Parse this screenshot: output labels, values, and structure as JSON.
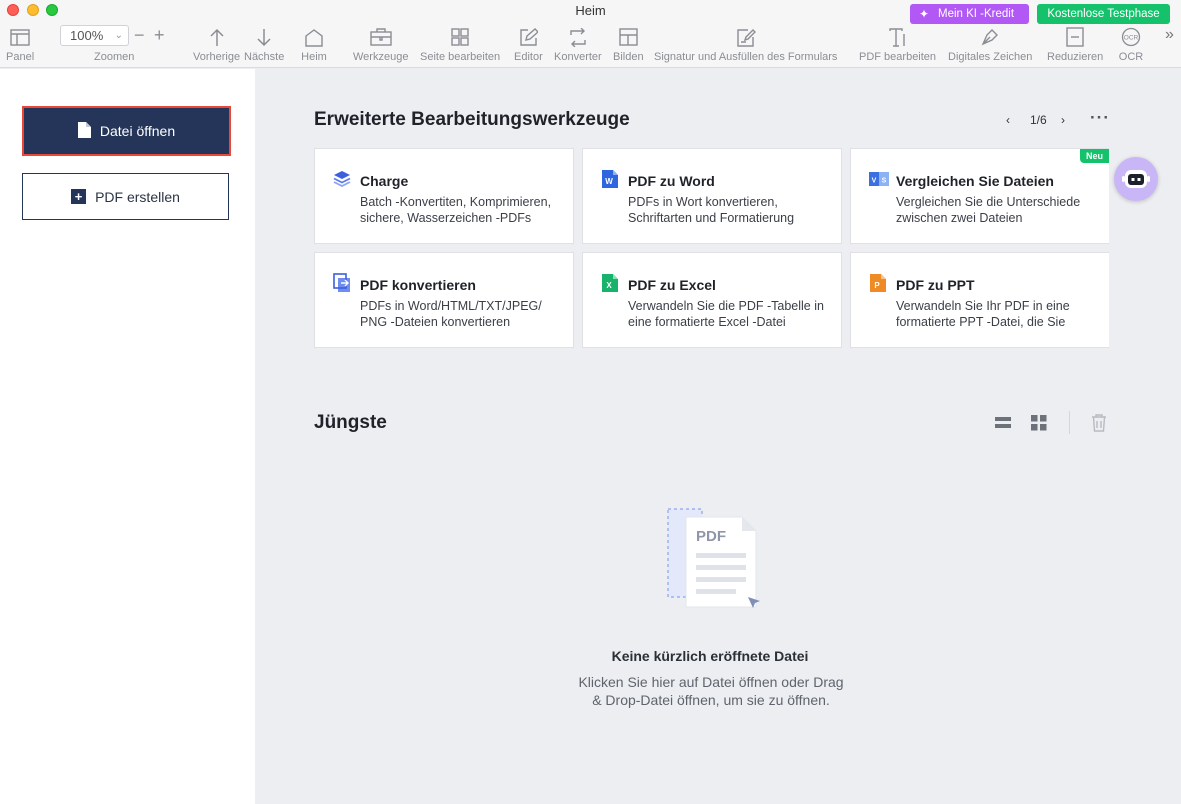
{
  "window": {
    "title": "Heim"
  },
  "promo": {
    "ki_credit": "Mein KI -Kredit",
    "trial": "Kostenlose Testphase"
  },
  "toolbar": {
    "panel": "Panel",
    "zoom_value": "100%",
    "zoom_label": "Zoomen",
    "prev": "Vorherige",
    "next": "Nächste",
    "home": "Heim",
    "tools": "Werkzeuge",
    "edit_page": "Seite bearbeiten",
    "editor": "Editor",
    "converter": "Konverter",
    "images": "Bilden",
    "sign": "Signatur und Ausfüllen des Formulars",
    "pdf_edit": "PDF bearbeiten",
    "digital_sign": "Digitales Zeichen",
    "reduce": "Reduzieren",
    "ocr": "OCR"
  },
  "sidebar": {
    "open_file": "Datei öffnen",
    "create_pdf": "PDF erstellen"
  },
  "advanced": {
    "title": "Erweiterte Bearbeitungswerkzeuge",
    "pager": "1/6",
    "cards": [
      {
        "title": "Charge",
        "desc": "Batch -Konvertiten, Komprimieren, sichere, Wasserzeichen -PDFs"
      },
      {
        "title": "PDF zu Word",
        "desc": "PDFs in Wort konvertieren, Schriftarten und Formatierung"
      },
      {
        "title": "Vergleichen Sie Dateien",
        "desc": "Vergleichen Sie die Unterschiede zwischen zwei Dateien",
        "badge": "Neu"
      },
      {
        "title": "PDF konvertieren",
        "desc": "PDFs in Word/HTML/TXT/JPEG/ PNG -Dateien konvertieren"
      },
      {
        "title": "PDF zu Excel",
        "desc": "Verwandeln Sie die PDF -Tabelle in eine formatierte Excel -Datei"
      },
      {
        "title": "PDF zu PPT",
        "desc": "Verwandeln Sie Ihr PDF in eine formatierte PPT -Datei, die Sie"
      }
    ]
  },
  "recent": {
    "title": "Jüngste",
    "illustration_label": "PDF",
    "empty_title": "Keine kürzlich eröffnete Datei",
    "empty_desc": "Klicken Sie hier auf Datei öffnen oder Drag & Drop-Datei öffnen, um sie zu öffnen."
  },
  "colors": {
    "primary": "#243559",
    "highlight": "#e8473a",
    "green": "#15c26b",
    "purple": "#b259f5"
  }
}
